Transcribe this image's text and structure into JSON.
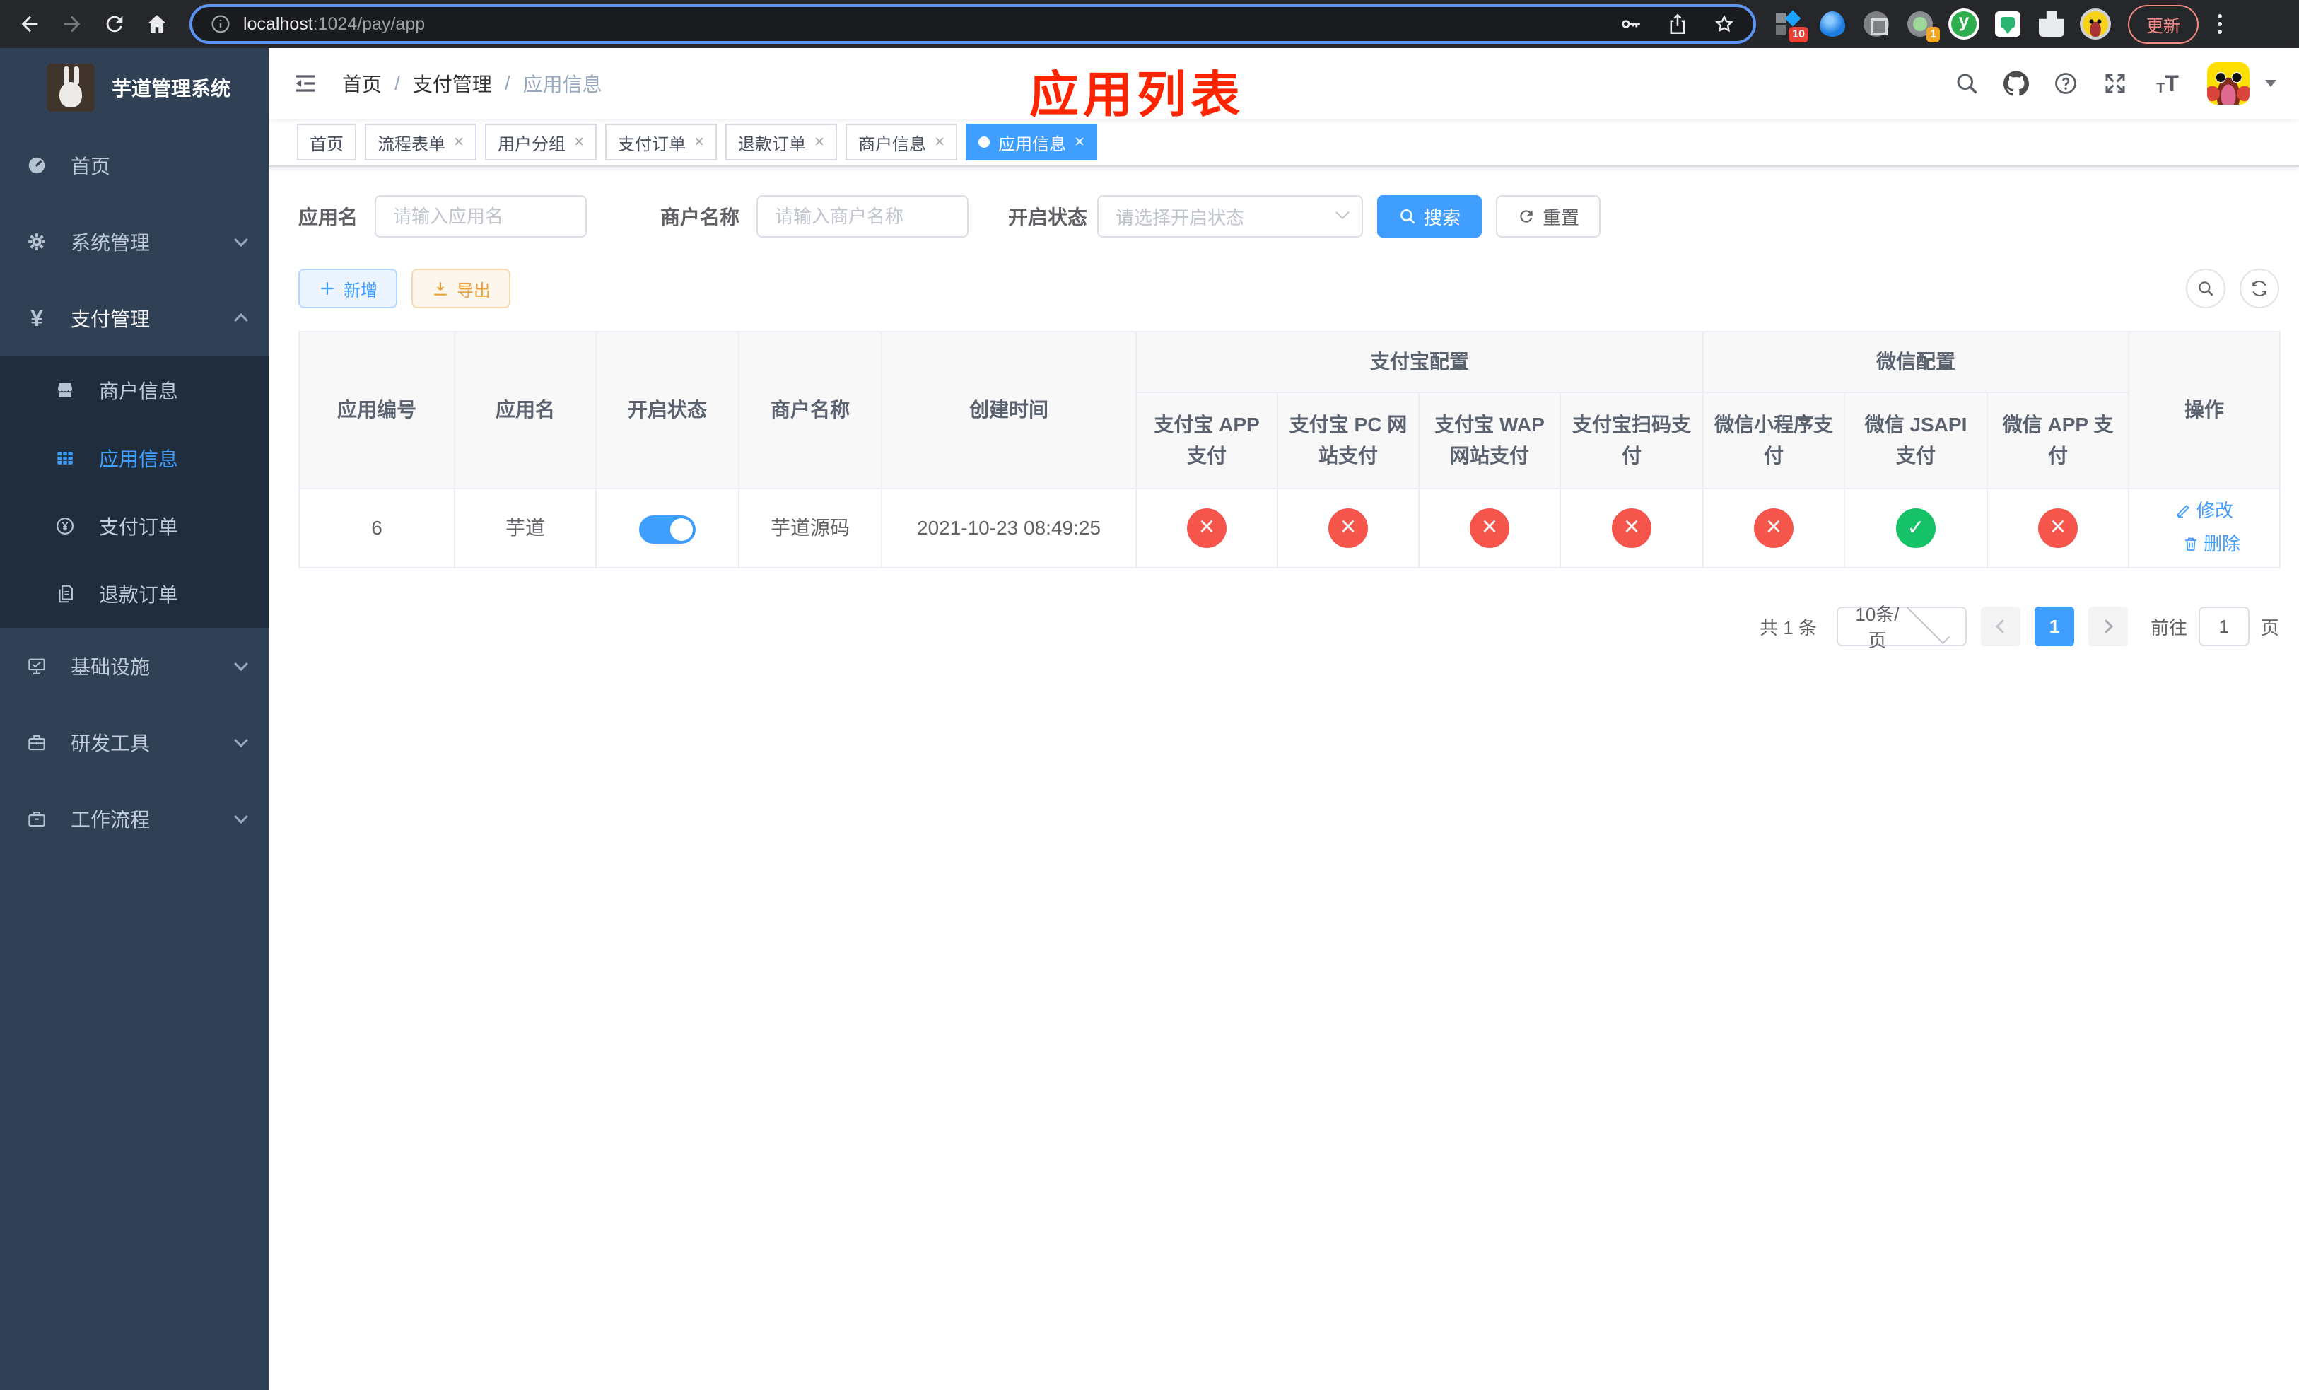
{
  "browser": {
    "url": {
      "host": "localhost",
      "rest": ":1024/pay/app"
    },
    "update_button": "更新",
    "ext_badge_tiles": "10",
    "ext_badge_ring": "1"
  },
  "annotation": "应用列表",
  "sidebar": {
    "title": "芋道管理系统",
    "menu": [
      {
        "label": "首页"
      },
      {
        "label": "系统管理"
      },
      {
        "label": "支付管理"
      },
      {
        "label": "基础设施"
      },
      {
        "label": "研发工具"
      },
      {
        "label": "工作流程"
      }
    ],
    "submenu": [
      {
        "label": "商户信息"
      },
      {
        "label": "应用信息"
      },
      {
        "label": "支付订单"
      },
      {
        "label": "退款订单"
      }
    ]
  },
  "navbar": {
    "breadcrumb": [
      "首页",
      "支付管理",
      "应用信息"
    ],
    "separator": "/"
  },
  "tabs": [
    {
      "label": "首页",
      "closable": false,
      "active": false
    },
    {
      "label": "流程表单",
      "closable": true,
      "active": false
    },
    {
      "label": "用户分组",
      "closable": true,
      "active": false
    },
    {
      "label": "支付订单",
      "closable": true,
      "active": false
    },
    {
      "label": "退款订单",
      "closable": true,
      "active": false
    },
    {
      "label": "商户信息",
      "closable": true,
      "active": false
    },
    {
      "label": "应用信息",
      "closable": true,
      "active": true
    }
  ],
  "filters": {
    "app_name": {
      "label": "应用名",
      "placeholder": "请输入应用名"
    },
    "merchant_name": {
      "label": "商户名称",
      "placeholder": "请输入商户名称"
    },
    "status": {
      "label": "开启状态",
      "placeholder": "请选择开启状态"
    },
    "search": "搜索",
    "reset": "重置"
  },
  "toolbar": {
    "add": "新增",
    "export": "导出"
  },
  "table": {
    "columns": [
      "应用编号",
      "应用名",
      "开启状态",
      "商户名称",
      "创建时间"
    ],
    "groups": [
      "支付宝配置",
      "微信配置"
    ],
    "pay_columns": [
      "支付宝 APP 支付",
      "支付宝 PC 网站支付",
      "支付宝 WAP 网站支付",
      "支付宝扫码支付",
      "微信小程序支付",
      "微信 JSAPI 支付",
      "微信 APP 支付"
    ],
    "ops_column": "操作",
    "rows": [
      {
        "id": "6",
        "name": "芋道",
        "enabled": true,
        "merchant": "芋道源码",
        "created": "2021-10-23 08:49:25",
        "statuses": [
          "fail",
          "fail",
          "fail",
          "fail",
          "fail",
          "success",
          "fail"
        ],
        "edit": "修改",
        "delete": "删除"
      }
    ]
  },
  "pagination": {
    "total": "共 1 条",
    "page_size": "10条/页",
    "current_page": "1",
    "goto_prefix": "前往",
    "goto_value": "1",
    "goto_suffix": "页"
  },
  "colors": {
    "primary": "#409eff",
    "success": "#15c268",
    "danger": "#f5554b",
    "warning": "#e6a23c",
    "annotation": "#ff2400"
  }
}
